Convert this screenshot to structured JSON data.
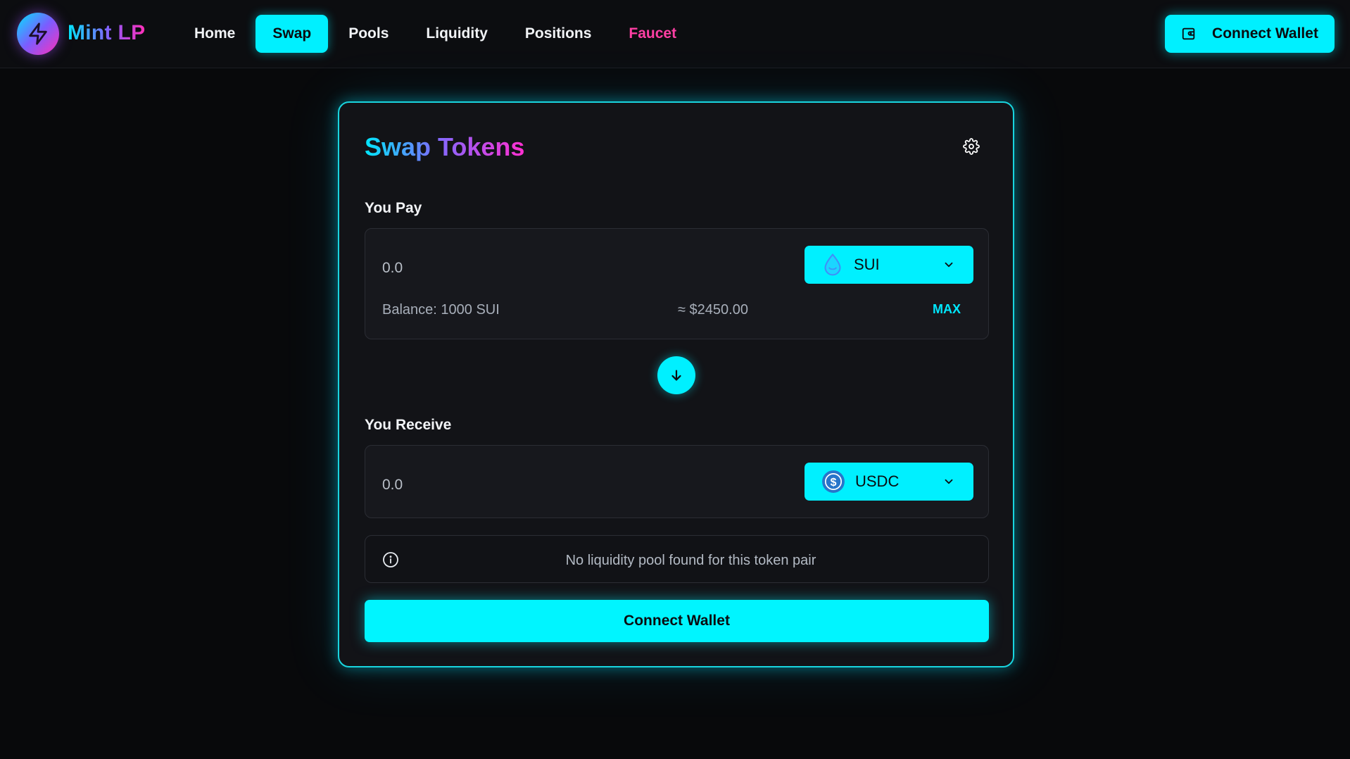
{
  "app": {
    "name": "Mint LP"
  },
  "nav": {
    "items": [
      {
        "label": "Home"
      },
      {
        "label": "Swap",
        "active": true
      },
      {
        "label": "Pools"
      },
      {
        "label": "Liquidity"
      },
      {
        "label": "Positions"
      },
      {
        "label": "Faucet"
      }
    ]
  },
  "header": {
    "connect_label": "Connect Wallet"
  },
  "card": {
    "title": "Swap Tokens",
    "pay": {
      "label": "You Pay",
      "amount_placeholder": "0.0",
      "token": "SUI",
      "token_icon": "sui-drop-icon",
      "balance": "Balance: 1000 SUI",
      "usd_value": "≈ $2450.00",
      "max_label": "MAX"
    },
    "receive": {
      "label": "You Receive",
      "amount_placeholder": "0.0",
      "token": "USDC",
      "token_icon": "usdc-coin-icon"
    },
    "notice": "No liquidity pool found for this token pair",
    "connect_label": "Connect Wallet"
  },
  "colors": {
    "accent": "#00f0ff",
    "faucet": "#ff3fa4",
    "background": "#08090b",
    "card": "#121317"
  }
}
